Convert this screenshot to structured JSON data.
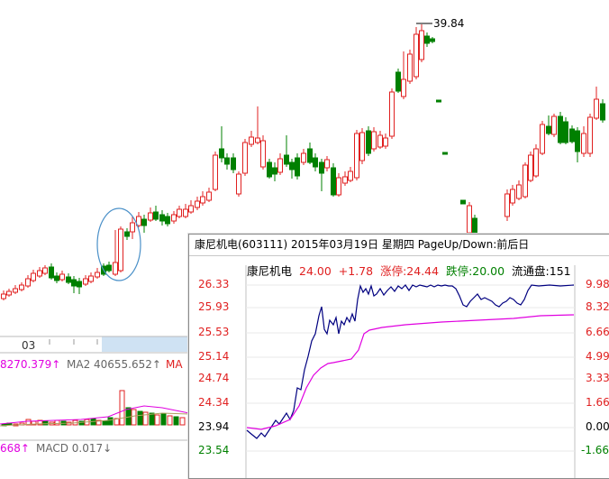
{
  "colors": {
    "up": "#e02020",
    "down": "#008000",
    "price_line": "#000080",
    "avg_line": "#e000e0",
    "magenta_text": "#e000e0",
    "grey_text": "#666666",
    "ellipse": "#4a90c8",
    "scrollbar": "#cfe2f3"
  },
  "background": {
    "peak_label": "39.84",
    "date_label": "03",
    "ma_line": {
      "ma1_tail": "8270.379↑",
      "ma2": "MA2 40655.652↑",
      "ma_cut": "MA"
    },
    "macd_line": {
      "prefix": "668↑",
      "macd": "MACD 0.017↓"
    }
  },
  "popup": {
    "title": "康尼机电(603111) 2015年03月19日 星期四 PageUp/Down:前后日",
    "info": {
      "name": "康尼机电",
      "price": "24.00",
      "change": "+1.78",
      "limit_up": "涨停:24.44",
      "limit_down": "跌停:20.00",
      "float": "流通盘:151"
    },
    "left_axis": [
      "26.33",
      "25.93",
      "25.53",
      "25.14",
      "24.74",
      "24.34",
      "23.94",
      "23.54"
    ],
    "right_axis": [
      "9.98",
      "8.32",
      "6.66",
      "4.99",
      "3.33",
      "1.66",
      "0.00",
      "-1.66"
    ]
  }
}
